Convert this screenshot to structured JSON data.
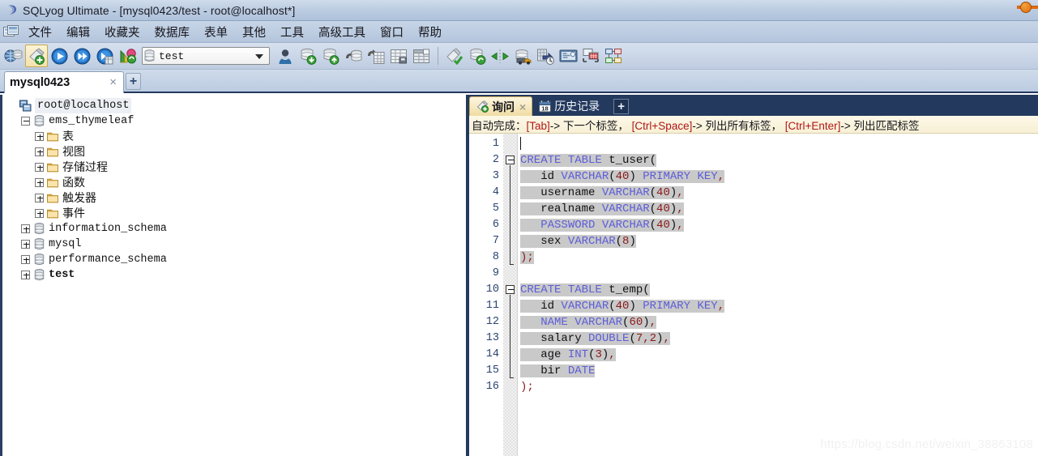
{
  "window": {
    "title": "SQLyog Ultimate - [mysql0423/test - root@localhost*]",
    "app_icon": "sqlyog-logo-icon",
    "control_dot": "minimize-dot-icon"
  },
  "menubar": {
    "app_icon": "window-menu-icon",
    "items": [
      {
        "label": "文件",
        "name": "menu-file"
      },
      {
        "label": "编辑",
        "name": "menu-edit"
      },
      {
        "label": "收藏夹",
        "name": "menu-favorites"
      },
      {
        "label": "数据库",
        "name": "menu-database"
      },
      {
        "label": "表单",
        "name": "menu-table"
      },
      {
        "label": "其他",
        "name": "menu-other"
      },
      {
        "label": "工具",
        "name": "menu-tools"
      },
      {
        "label": "高级工具",
        "name": "menu-powertools"
      },
      {
        "label": "窗口",
        "name": "menu-window"
      },
      {
        "label": "帮助",
        "name": "menu-help"
      }
    ]
  },
  "toolbar": {
    "db_select": {
      "value": "test",
      "icon": "database-icon"
    },
    "buttons": [
      {
        "name": "new-connection-button",
        "icon": "connection-globe-icon",
        "selected": false
      },
      {
        "name": "new-query-tab-button",
        "icon": "new-query-icon",
        "selected": true
      },
      {
        "name": "execute-query-button",
        "icon": "execute-play-icon",
        "selected": false
      },
      {
        "name": "execute-all-queries-button",
        "icon": "execute-all-forward-icon",
        "selected": false
      },
      {
        "name": "execute-query-new-tab-button",
        "icon": "execute-new-tab-icon",
        "selected": false
      },
      {
        "name": "refresh-object-browser-button",
        "icon": "refresh-tree-icon",
        "selected": false
      },
      {
        "name": "user-manager-button",
        "icon": "user-manager-icon",
        "selected": false
      },
      {
        "name": "backup-database-button",
        "icon": "database-export-icon",
        "selected": false
      },
      {
        "name": "restore-database-button",
        "icon": "database-import-icon",
        "selected": false
      },
      {
        "name": "import-external-data-button",
        "icon": "import-data-icon",
        "selected": false
      },
      {
        "name": "export-data-button",
        "icon": "export-grid-icon",
        "selected": false
      },
      {
        "name": "create-table-button",
        "icon": "table-new-icon",
        "selected": false
      },
      {
        "name": "manage-indexes-button",
        "icon": "table-structure-icon",
        "selected": false
      },
      {
        "name": "new-object-button",
        "icon": "new-object-check-icon",
        "selected": false
      },
      {
        "name": "flush-button",
        "icon": "database-refresh-icon",
        "selected": false
      },
      {
        "name": "sync-structure-button",
        "icon": "sync-arrows-icon",
        "selected": false
      },
      {
        "name": "migrate-data-button",
        "icon": "data-truck-icon",
        "selected": false
      },
      {
        "name": "scheduled-backup-button",
        "icon": "backup-clock-icon",
        "selected": false
      },
      {
        "name": "sql-monitor-button",
        "icon": "monitor-screen-icon",
        "selected": false
      },
      {
        "name": "query-builder-button",
        "icon": "query-builder-icon",
        "selected": false
      },
      {
        "name": "schema-designer-button",
        "icon": "schema-designer-icon",
        "selected": false
      }
    ]
  },
  "connection_tabs": {
    "tabs": [
      {
        "label": "mysql0423",
        "close": "×",
        "active": true
      }
    ],
    "add_label": "+"
  },
  "object_browser": {
    "nodes": [
      {
        "label": "root@localhost",
        "icon": "server-icon",
        "indent": 0,
        "expander": "none",
        "style": "root"
      },
      {
        "label": "ems_thymeleaf",
        "icon": "database-icon",
        "indent": 1,
        "expander": "collapse",
        "style": "mono"
      },
      {
        "label": "表",
        "icon": "folder-icon",
        "indent": 2,
        "expander": "expand",
        "style": "cn"
      },
      {
        "label": "视图",
        "icon": "folder-icon",
        "indent": 2,
        "expander": "expand",
        "style": "cn"
      },
      {
        "label": "存储过程",
        "icon": "folder-icon",
        "indent": 2,
        "expander": "expand",
        "style": "cn"
      },
      {
        "label": "函数",
        "icon": "folder-icon",
        "indent": 2,
        "expander": "expand",
        "style": "cn"
      },
      {
        "label": "触发器",
        "icon": "folder-icon",
        "indent": 2,
        "expander": "expand",
        "style": "cn"
      },
      {
        "label": "事件",
        "icon": "folder-icon",
        "indent": 2,
        "expander": "expand",
        "style": "cn"
      },
      {
        "label": "information_schema",
        "icon": "database-icon",
        "indent": 1,
        "expander": "expand",
        "style": "mono"
      },
      {
        "label": "mysql",
        "icon": "database-icon",
        "indent": 1,
        "expander": "expand",
        "style": "mono"
      },
      {
        "label": "performance_schema",
        "icon": "database-icon",
        "indent": 1,
        "expander": "expand",
        "style": "mono"
      },
      {
        "label": "test",
        "icon": "database-icon",
        "indent": 1,
        "expander": "expand",
        "style": "mono-bold"
      }
    ]
  },
  "editor": {
    "tabs": [
      {
        "label": "询问",
        "icon": "query-tab-icon",
        "close": "×",
        "active": true
      },
      {
        "label": "历史记录",
        "icon": "calendar-18-icon",
        "close": "",
        "active": false
      }
    ],
    "add_label": "+",
    "hint": {
      "prefix": "自动完成：",
      "parts": [
        {
          "key": "[Tab]",
          "text": "-> 下一个标签，"
        },
        {
          "key": "[Ctrl+Space]",
          "text": "-> 列出所有标签，"
        },
        {
          "key": "[Ctrl+Enter]",
          "text": "-> 列出匹配标签"
        }
      ]
    },
    "line_numbers": [
      1,
      2,
      3,
      4,
      5,
      6,
      7,
      8,
      9,
      10,
      11,
      12,
      13,
      14,
      15,
      16
    ],
    "sql_lines": [
      {
        "n": 1,
        "selected": false,
        "caret": true,
        "tokens": []
      },
      {
        "n": 2,
        "selected": true,
        "fold": "start",
        "tokens": [
          {
            "t": "CREATE",
            "c": "kw"
          },
          {
            "t": " ",
            "c": "id"
          },
          {
            "t": "TABLE",
            "c": "kw"
          },
          {
            "t": " ",
            "c": "id"
          },
          {
            "t": "t_user",
            "c": "id"
          },
          {
            "t": "(",
            "c": "id"
          }
        ]
      },
      {
        "n": 3,
        "selected": true,
        "tokens": [
          {
            "t": "   id ",
            "c": "id"
          },
          {
            "t": "VARCHAR",
            "c": "kw"
          },
          {
            "t": "(",
            "c": "id"
          },
          {
            "t": "40",
            "c": "num"
          },
          {
            "t": ") ",
            "c": "id"
          },
          {
            "t": "PRIMARY KEY",
            "c": "kw"
          },
          {
            "t": ",",
            "c": "pn"
          }
        ]
      },
      {
        "n": 4,
        "selected": true,
        "tokens": [
          {
            "t": "   username ",
            "c": "id"
          },
          {
            "t": "VARCHAR",
            "c": "kw"
          },
          {
            "t": "(",
            "c": "id"
          },
          {
            "t": "40",
            "c": "num"
          },
          {
            "t": ")",
            "c": "id"
          },
          {
            "t": ",",
            "c": "pn"
          }
        ]
      },
      {
        "n": 5,
        "selected": true,
        "tokens": [
          {
            "t": "   realname ",
            "c": "id"
          },
          {
            "t": "VARCHAR",
            "c": "kw"
          },
          {
            "t": "(",
            "c": "id"
          },
          {
            "t": "40",
            "c": "num"
          },
          {
            "t": ")",
            "c": "id"
          },
          {
            "t": ",",
            "c": "pn"
          }
        ]
      },
      {
        "n": 6,
        "selected": true,
        "tokens": [
          {
            "t": "   ",
            "c": "id"
          },
          {
            "t": "PASSWORD",
            "c": "kw"
          },
          {
            "t": " ",
            "c": "id"
          },
          {
            "t": "VARCHAR",
            "c": "kw"
          },
          {
            "t": "(",
            "c": "id"
          },
          {
            "t": "40",
            "c": "num"
          },
          {
            "t": ")",
            "c": "id"
          },
          {
            "t": ",",
            "c": "pn"
          }
        ]
      },
      {
        "n": 7,
        "selected": true,
        "tokens": [
          {
            "t": "   sex ",
            "c": "id"
          },
          {
            "t": "VARCHAR",
            "c": "kw"
          },
          {
            "t": "(",
            "c": "id"
          },
          {
            "t": "8",
            "c": "num"
          },
          {
            "t": ")",
            "c": "id"
          }
        ]
      },
      {
        "n": 8,
        "selected": true,
        "fold": "end",
        "tokens": [
          {
            "t": ")",
            "c": "pn"
          },
          {
            "t": ";",
            "c": "pn"
          }
        ]
      },
      {
        "n": 9,
        "selected": false,
        "tokens": []
      },
      {
        "n": 10,
        "selected": true,
        "fold": "start",
        "tokens": [
          {
            "t": "CREATE",
            "c": "kw"
          },
          {
            "t": " ",
            "c": "id"
          },
          {
            "t": "TABLE",
            "c": "kw"
          },
          {
            "t": " ",
            "c": "id"
          },
          {
            "t": "t_emp",
            "c": "id"
          },
          {
            "t": "(",
            "c": "id"
          }
        ]
      },
      {
        "n": 11,
        "selected": true,
        "tokens": [
          {
            "t": "   id ",
            "c": "id"
          },
          {
            "t": "VARCHAR",
            "c": "kw"
          },
          {
            "t": "(",
            "c": "id"
          },
          {
            "t": "40",
            "c": "num"
          },
          {
            "t": ") ",
            "c": "id"
          },
          {
            "t": "PRIMARY KEY",
            "c": "kw"
          },
          {
            "t": ",",
            "c": "pn"
          }
        ]
      },
      {
        "n": 12,
        "selected": true,
        "tokens": [
          {
            "t": "   ",
            "c": "id"
          },
          {
            "t": "NAME",
            "c": "kw"
          },
          {
            "t": " ",
            "c": "id"
          },
          {
            "t": "VARCHAR",
            "c": "kw"
          },
          {
            "t": "(",
            "c": "id"
          },
          {
            "t": "60",
            "c": "num"
          },
          {
            "t": ")",
            "c": "id"
          },
          {
            "t": ",",
            "c": "pn"
          }
        ]
      },
      {
        "n": 13,
        "selected": true,
        "tokens": [
          {
            "t": "   salary ",
            "c": "id"
          },
          {
            "t": "DOUBLE",
            "c": "kw"
          },
          {
            "t": "(",
            "c": "id"
          },
          {
            "t": "7,2",
            "c": "num"
          },
          {
            "t": ")",
            "c": "id"
          },
          {
            "t": ",",
            "c": "pn"
          }
        ]
      },
      {
        "n": 14,
        "selected": true,
        "tokens": [
          {
            "t": "   age ",
            "c": "id"
          },
          {
            "t": "INT",
            "c": "kw"
          },
          {
            "t": "(",
            "c": "id"
          },
          {
            "t": "3",
            "c": "num"
          },
          {
            "t": ")",
            "c": "id"
          },
          {
            "t": ",",
            "c": "pn"
          }
        ]
      },
      {
        "n": 15,
        "selected": true,
        "fold": "end",
        "tokens": [
          {
            "t": "   bir ",
            "c": "id"
          },
          {
            "t": "DATE",
            "c": "kw"
          }
        ]
      },
      {
        "n": 16,
        "selected": false,
        "tokens": [
          {
            "t": ")",
            "c": "pn"
          },
          {
            "t": ";",
            "c": "pn"
          }
        ]
      }
    ]
  },
  "watermark": "https://blog.csdn.net/weixin_38863108",
  "colors": {
    "titlebar": "#bdcde2",
    "toolbar": "#cbd7e8",
    "tab_accent": "#24395e",
    "active_tab": "#f6e9bf",
    "keyword": "#5d5dd8",
    "number": "#8b1a1a",
    "selection": "#c9c9c9",
    "hint_key": "#b01818"
  }
}
